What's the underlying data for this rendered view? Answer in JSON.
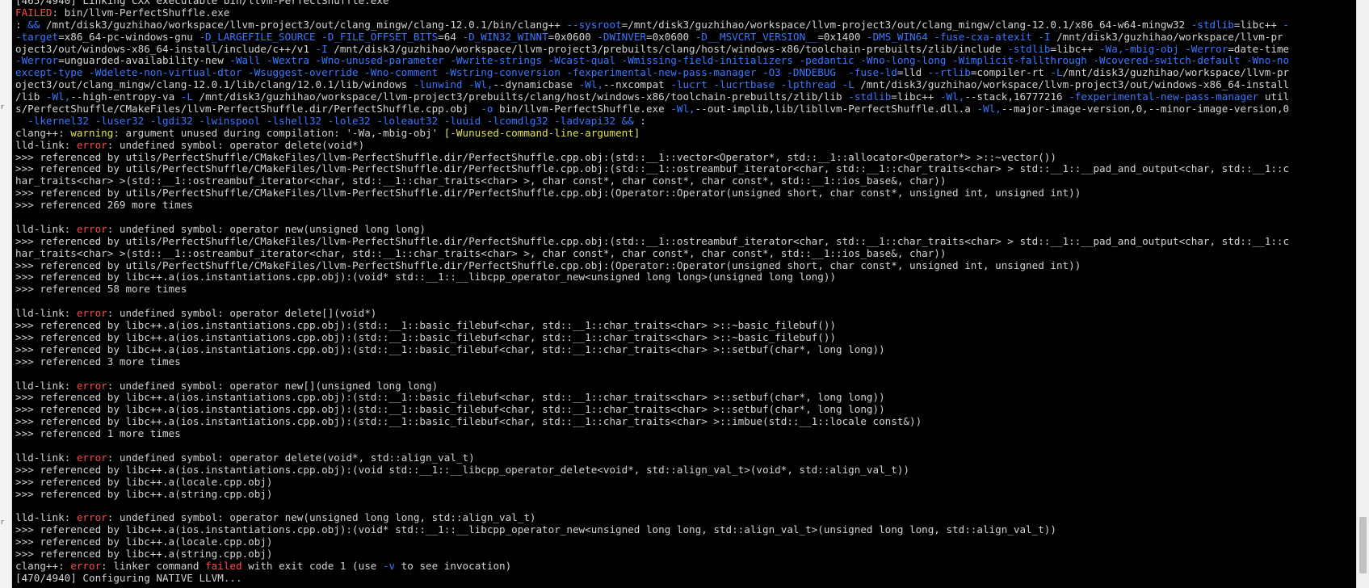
{
  "colors": {
    "background": "#000000",
    "text": "#d3d3d3",
    "flag": "#3a78ff",
    "error": "#ff4a4a",
    "warning": "#e5e05a"
  },
  "left_strip_chars": [
    "r",
    "r"
  ],
  "lines": [
    [
      {
        "t": "[465/4940] Linking CXX executable bin/llvm-PerfectShuffle.exe",
        "c": "t"
      }
    ],
    [
      {
        "t": "FAILED",
        "c": "e"
      },
      {
        "t": ": bin/llvm-PerfectShuffle.exe",
        "c": "t"
      }
    ],
    [
      {
        "t": ": ",
        "c": "t"
      },
      {
        "t": "&&",
        "c": "f"
      },
      {
        "t": " /mnt/disk3/guzhihao/workspace/llvm-project3/out/clang_mingw/clang-12.0.1/bin/clang++ ",
        "c": "t"
      },
      {
        "t": "--sysroot",
        "c": "f"
      },
      {
        "t": "=/mnt/disk3/guzhihao/workspace/llvm-project3/out/clang_mingw/clang-12.0.1/x86_64-w64-mingw32 ",
        "c": "t"
      },
      {
        "t": "-stdlib",
        "c": "f"
      },
      {
        "t": "=libc++ ",
        "c": "t"
      },
      {
        "t": "-",
        "c": "f"
      }
    ],
    [
      {
        "t": "-target",
        "c": "f"
      },
      {
        "t": "=x86_64-pc-windows-gnu ",
        "c": "t"
      },
      {
        "t": "-D_LARGEFILE_SOURCE -D_FILE_OFFSET_BITS",
        "c": "f"
      },
      {
        "t": "=64 ",
        "c": "t"
      },
      {
        "t": "-D_WIN32_WINNT",
        "c": "f"
      },
      {
        "t": "=0x0600 ",
        "c": "t"
      },
      {
        "t": "-DWINVER",
        "c": "f"
      },
      {
        "t": "=0x0600 ",
        "c": "t"
      },
      {
        "t": "-D__MSVCRT_VERSION__",
        "c": "f"
      },
      {
        "t": "=0x1400 ",
        "c": "t"
      },
      {
        "t": "-DMS_WIN64 -fuse-cxa-atexit -I",
        "c": "f"
      },
      {
        "t": " /mnt/disk3/guzhihao/workspace/llvm-pr",
        "c": "t"
      }
    ],
    [
      {
        "t": "oject3/out/windows-x86_64-install/include/c++/v1 ",
        "c": "t"
      },
      {
        "t": "-I",
        "c": "f"
      },
      {
        "t": " /mnt/disk3/guzhihao/workspace/llvm-project3/prebuilts/clang/host/windows-x86/toolchain-prebuilts/zlib/include ",
        "c": "t"
      },
      {
        "t": "-stdlib",
        "c": "f"
      },
      {
        "t": "=libc++ ",
        "c": "t"
      },
      {
        "t": "-Wa,-mbig-obj -Werror",
        "c": "f"
      },
      {
        "t": "=date-time",
        "c": "t"
      }
    ],
    [
      {
        "t": "-Werror",
        "c": "f"
      },
      {
        "t": "=unguarded-availability-new ",
        "c": "t"
      },
      {
        "t": "-Wall -Wextra -Wno-unused-parameter -Wwrite-strings -Wcast-qual -Wmissing-field-initializers -pedantic -Wno-long-long -Wimplicit-fallthrough -Wcovered-switch-default -Wno-no",
        "c": "f"
      }
    ],
    [
      {
        "t": "except-type -Wdelete-non-virtual-dtor -Wsuggest-override -Wno-comment -Wstring-conversion -fexperimental-new-pass-manager -O3 -DNDEBUG  -fuse-ld",
        "c": "f"
      },
      {
        "t": "=lld ",
        "c": "t"
      },
      {
        "t": "--rtlib",
        "c": "f"
      },
      {
        "t": "=compiler-rt ",
        "c": "t"
      },
      {
        "t": "-L",
        "c": "f"
      },
      {
        "t": "/mnt/disk3/guzhihao/workspace/llvm-pr",
        "c": "t"
      }
    ],
    [
      {
        "t": "oject3/out/clang_mingw/clang-12.0.1/lib/clang/12.0.1/lib/windows ",
        "c": "t"
      },
      {
        "t": "-lunwind -Wl,",
        "c": "f"
      },
      {
        "t": "--dynamicbase ",
        "c": "t"
      },
      {
        "t": "-Wl,",
        "c": "f"
      },
      {
        "t": "--nxcompat ",
        "c": "t"
      },
      {
        "t": "-lucrt -lucrtbase -lpthread -L",
        "c": "f"
      },
      {
        "t": " /mnt/disk3/guzhihao/workspace/llvm-project3/out/windows-x86_64-install",
        "c": "t"
      }
    ],
    [
      {
        "t": "/lib ",
        "c": "t"
      },
      {
        "t": "-Wl,",
        "c": "f"
      },
      {
        "t": "--high-entropy-va ",
        "c": "t"
      },
      {
        "t": "-L",
        "c": "f"
      },
      {
        "t": " /mnt/disk3/guzhihao/workspace/llvm-project3/prebuilts/clang/host/windows-x86/toolchain-prebuilts/zlib/lib ",
        "c": "t"
      },
      {
        "t": "-stdlib",
        "c": "f"
      },
      {
        "t": "=libc++ ",
        "c": "t"
      },
      {
        "t": "-Wl,",
        "c": "f"
      },
      {
        "t": "--stack,16777216 ",
        "c": "t"
      },
      {
        "t": "-fexperimental-new-pass-manager",
        "c": "f"
      },
      {
        "t": " util",
        "c": "t"
      }
    ],
    [
      {
        "t": "s/PerfectShuffle/CMakeFiles/llvm-PerfectShuffle.dir/PerfectShuffle.cpp.obj  ",
        "c": "t"
      },
      {
        "t": "-o",
        "c": "f"
      },
      {
        "t": " bin/llvm-PerfectShuffle.exe ",
        "c": "t"
      },
      {
        "t": "-Wl,",
        "c": "f"
      },
      {
        "t": "--out-implib,lib/libllvm-PerfectShuffle.dll.a ",
        "c": "t"
      },
      {
        "t": "-Wl,",
        "c": "f"
      },
      {
        "t": "--major-image-version,0,--minor-image-version,0",
        "c": "t"
      }
    ],
    [
      {
        "t": "  -lkernel32 -luser32 -lgdi32 -lwinspool -lshell32 -lole32 -loleaut32 -luuid -lcomdlg32 -ladvapi32 ",
        "c": "f"
      },
      {
        "t": "&&",
        "c": "f"
      },
      {
        "t": " :",
        "c": "t"
      }
    ],
    [
      {
        "t": "clang++: ",
        "c": "t"
      },
      {
        "t": "warning",
        "c": "w"
      },
      {
        "t": ": argument unused during compilation: '-Wa,-mbig-obj' ",
        "c": "t"
      },
      {
        "t": "[-Wunused-command-line-argument]",
        "c": "o"
      }
    ],
    [
      {
        "t": "lld-link: ",
        "c": "t"
      },
      {
        "t": "error",
        "c": "e"
      },
      {
        "t": ": undefined symbol: operator delete(void*)",
        "c": "t"
      }
    ],
    [
      {
        "t": ">>> referenced by utils/PerfectShuffle/CMakeFiles/llvm-PerfectShuffle.dir/PerfectShuffle.cpp.obj:(std::__1::vector<Operator*, std::__1::allocator<Operator*> >::~vector())",
        "c": "t"
      }
    ],
    [
      {
        "t": ">>> referenced by utils/PerfectShuffle/CMakeFiles/llvm-PerfectShuffle.dir/PerfectShuffle.cpp.obj:(std::__1::ostreambuf_iterator<char, std::__1::char_traits<char> > std::__1::__pad_and_output<char, std::__1::c",
        "c": "t"
      }
    ],
    [
      {
        "t": "har_traits<char> >(std::__1::ostreambuf_iterator<char, std::__1::char_traits<char> >, char const*, char const*, char const*, std::__1::ios_base&, char))",
        "c": "t"
      }
    ],
    [
      {
        "t": ">>> referenced by utils/PerfectShuffle/CMakeFiles/llvm-PerfectShuffle.dir/PerfectShuffle.cpp.obj:(Operator::Operator(unsigned short, char const*, unsigned int, unsigned int))",
        "c": "t"
      }
    ],
    [
      {
        "t": ">>> referenced 269 more times",
        "c": "t"
      }
    ],
    [
      {
        "t": "",
        "c": "t"
      }
    ],
    [
      {
        "t": "lld-link: ",
        "c": "t"
      },
      {
        "t": "error",
        "c": "e"
      },
      {
        "t": ": undefined symbol: operator new(unsigned long long)",
        "c": "t"
      }
    ],
    [
      {
        "t": ">>> referenced by utils/PerfectShuffle/CMakeFiles/llvm-PerfectShuffle.dir/PerfectShuffle.cpp.obj:(std::__1::ostreambuf_iterator<char, std::__1::char_traits<char> > std::__1::__pad_and_output<char, std::__1::c",
        "c": "t"
      }
    ],
    [
      {
        "t": "har_traits<char> >(std::__1::ostreambuf_iterator<char, std::__1::char_traits<char> >, char const*, char const*, char const*, std::__1::ios_base&, char))",
        "c": "t"
      }
    ],
    [
      {
        "t": ">>> referenced by utils/PerfectShuffle/CMakeFiles/llvm-PerfectShuffle.dir/PerfectShuffle.cpp.obj:(Operator::Operator(unsigned short, char const*, unsigned int, unsigned int))",
        "c": "t"
      }
    ],
    [
      {
        "t": ">>> referenced by libc++.a(ios.instantiations.cpp.obj):(void* std::__1::__libcpp_operator_new<unsigned long long>(unsigned long long))",
        "c": "t"
      }
    ],
    [
      {
        "t": ">>> referenced 58 more times",
        "c": "t"
      }
    ],
    [
      {
        "t": "",
        "c": "t"
      }
    ],
    [
      {
        "t": "lld-link: ",
        "c": "t"
      },
      {
        "t": "error",
        "c": "e"
      },
      {
        "t": ": undefined symbol: operator delete[](void*)",
        "c": "t"
      }
    ],
    [
      {
        "t": ">>> referenced by libc++.a(ios.instantiations.cpp.obj):(std::__1::basic_filebuf<char, std::__1::char_traits<char> >::~basic_filebuf())",
        "c": "t"
      }
    ],
    [
      {
        "t": ">>> referenced by libc++.a(ios.instantiations.cpp.obj):(std::__1::basic_filebuf<char, std::__1::char_traits<char> >::~basic_filebuf())",
        "c": "t"
      }
    ],
    [
      {
        "t": ">>> referenced by libc++.a(ios.instantiations.cpp.obj):(std::__1::basic_filebuf<char, std::__1::char_traits<char> >::setbuf(char*, long long))",
        "c": "t"
      }
    ],
    [
      {
        "t": ">>> referenced 3 more times",
        "c": "t"
      }
    ],
    [
      {
        "t": "",
        "c": "t"
      }
    ],
    [
      {
        "t": "lld-link: ",
        "c": "t"
      },
      {
        "t": "error",
        "c": "e"
      },
      {
        "t": ": undefined symbol: operator new[](unsigned long long)",
        "c": "t"
      }
    ],
    [
      {
        "t": ">>> referenced by libc++.a(ios.instantiations.cpp.obj):(std::__1::basic_filebuf<char, std::__1::char_traits<char> >::setbuf(char*, long long))",
        "c": "t"
      }
    ],
    [
      {
        "t": ">>> referenced by libc++.a(ios.instantiations.cpp.obj):(std::__1::basic_filebuf<char, std::__1::char_traits<char> >::setbuf(char*, long long))",
        "c": "t"
      }
    ],
    [
      {
        "t": ">>> referenced by libc++.a(ios.instantiations.cpp.obj):(std::__1::basic_filebuf<char, std::__1::char_traits<char> >::imbue(std::__1::locale const&))",
        "c": "t"
      }
    ],
    [
      {
        "t": ">>> referenced 1 more times",
        "c": "t"
      }
    ],
    [
      {
        "t": "",
        "c": "t"
      }
    ],
    [
      {
        "t": "lld-link: ",
        "c": "t"
      },
      {
        "t": "error",
        "c": "e"
      },
      {
        "t": ": undefined symbol: operator delete(void*, std::align_val_t)",
        "c": "t"
      }
    ],
    [
      {
        "t": ">>> referenced by libc++.a(ios.instantiations.cpp.obj):(void std::__1::__libcpp_operator_delete<void*, std::align_val_t>(void*, std::align_val_t))",
        "c": "t"
      }
    ],
    [
      {
        "t": ">>> referenced by libc++.a(locale.cpp.obj)",
        "c": "t"
      }
    ],
    [
      {
        "t": ">>> referenced by libc++.a(string.cpp.obj)",
        "c": "t"
      }
    ],
    [
      {
        "t": "",
        "c": "t"
      }
    ],
    [
      {
        "t": "lld-link: ",
        "c": "t"
      },
      {
        "t": "error",
        "c": "e"
      },
      {
        "t": ": undefined symbol: operator new(unsigned long long, std::align_val_t)",
        "c": "t"
      }
    ],
    [
      {
        "t": ">>> referenced by libc++.a(ios.instantiations.cpp.obj):(void* std::__1::__libcpp_operator_new<unsigned long long, std::align_val_t>(unsigned long long, std::align_val_t))",
        "c": "t"
      }
    ],
    [
      {
        "t": ">>> referenced by libc++.a(locale.cpp.obj)",
        "c": "t"
      }
    ],
    [
      {
        "t": ">>> referenced by libc++.a(string.cpp.obj)",
        "c": "t"
      }
    ],
    [
      {
        "t": "clang++: ",
        "c": "t"
      },
      {
        "t": "error",
        "c": "e"
      },
      {
        "t": ": linker command ",
        "c": "t"
      },
      {
        "t": "failed",
        "c": "e"
      },
      {
        "t": " with exit code 1 (use ",
        "c": "t"
      },
      {
        "t": "-v",
        "c": "f"
      },
      {
        "t": " to see invocation)",
        "c": "t"
      }
    ],
    [
      {
        "t": "[470/4940] Configuring NATIVE LLVM...",
        "c": "t"
      }
    ]
  ]
}
